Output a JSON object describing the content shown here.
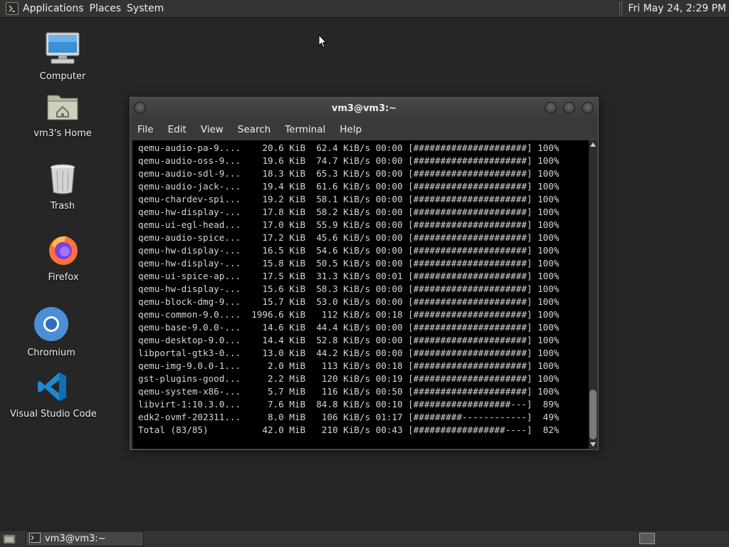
{
  "top_panel": {
    "logo_icon": "terminal-logo-icon",
    "menus": [
      "Applications",
      "Places",
      "System"
    ],
    "clock": "Fri May 24,  2:29 PM"
  },
  "desktop_icons": [
    {
      "label": "Computer",
      "icon": "computer-icon"
    },
    {
      "label": "vm3's Home",
      "icon": "home-folder-icon"
    },
    {
      "label": "Trash",
      "icon": "trash-icon"
    },
    {
      "label": "Firefox",
      "icon": "firefox-icon"
    },
    {
      "label": "Chromium",
      "icon": "chromium-icon"
    },
    {
      "label": "Visual Studio Code",
      "icon": "vscode-icon"
    }
  ],
  "terminal": {
    "title": "vm3@vm3:~",
    "menu": [
      "File",
      "Edit",
      "View",
      "Search",
      "Terminal",
      "Help"
    ],
    "lines": [
      "qemu-audio-pa-9....    20.6 KiB  62.4 KiB/s 00:00 [#####################] 100%",
      "qemu-audio-oss-9...    19.6 KiB  74.7 KiB/s 00:00 [#####################] 100%",
      "qemu-audio-sdl-9...    18.3 KiB  65.3 KiB/s 00:00 [#####################] 100%",
      "qemu-audio-jack-...    19.4 KiB  61.6 KiB/s 00:00 [#####################] 100%",
      "qemu-chardev-spi...    19.2 KiB  58.1 KiB/s 00:00 [#####################] 100%",
      "qemu-hw-display-...    17.8 KiB  58.2 KiB/s 00:00 [#####################] 100%",
      "qemu-ui-egl-head...    17.0 KiB  55.9 KiB/s 00:00 [#####################] 100%",
      "qemu-audio-spice...    17.2 KiB  45.6 KiB/s 00:00 [#####################] 100%",
      "qemu-hw-display-...    16.5 KiB  54.6 KiB/s 00:00 [#####################] 100%",
      "qemu-hw-display-...    15.8 KiB  50.5 KiB/s 00:00 [#####################] 100%",
      "qemu-ui-spice-ap...    17.5 KiB  31.3 KiB/s 00:01 [#####################] 100%",
      "qemu-hw-display-...    15.6 KiB  58.3 KiB/s 00:00 [#####################] 100%",
      "qemu-block-dmg-9...    15.7 KiB  53.0 KiB/s 00:00 [#####################] 100%",
      "qemu-common-9.0....  1996.6 KiB   112 KiB/s 00:18 [#####################] 100%",
      "qemu-base-9.0.0-...    14.6 KiB  44.4 KiB/s 00:00 [#####################] 100%",
      "qemu-desktop-9.0...    14.4 KiB  52.8 KiB/s 00:00 [#####################] 100%",
      "libportal-gtk3-0...    13.0 KiB  44.2 KiB/s 00:00 [#####################] 100%",
      "qemu-img-9.0.0-1...     2.0 MiB   113 KiB/s 00:18 [#####################] 100%",
      "gst-plugins-good...     2.2 MiB   120 KiB/s 00:19 [#####################] 100%",
      "qemu-system-x86-...     5.7 MiB   116 KiB/s 00:50 [#####################] 100%",
      "libvirt-1:10.3.0...     7.6 MiB  84.8 KiB/s 00:10 [##################---]  89%",
      "edk2-ovmf-202311...     8.0 MiB   106 KiB/s 01:17 [#########------------]  49%",
      "Total (83/85)          42.0 MiB   210 KiB/s 00:43 [#################----]  82%"
    ]
  },
  "taskbar": {
    "show_desktop_icon": "show-desktop-icon",
    "task_label": "vm3@vm3:~",
    "task_icon": "terminal-icon"
  }
}
